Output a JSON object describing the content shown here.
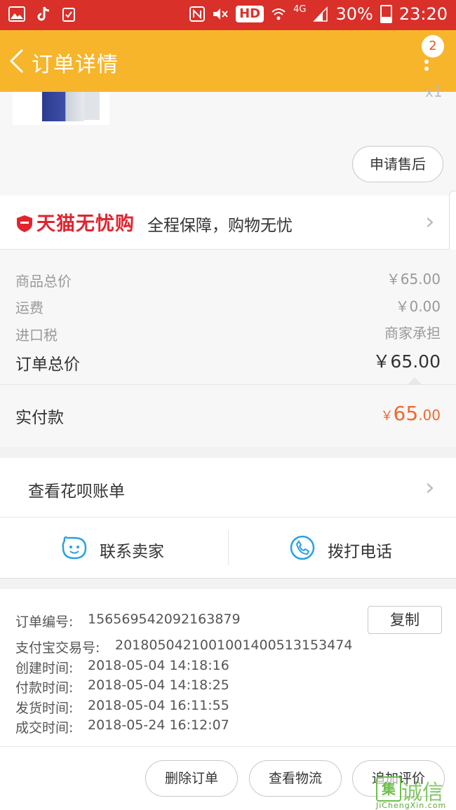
{
  "status_bar": {
    "left_icons": [
      "gallery-icon",
      "tiktok-icon",
      "clipboard-check-icon"
    ],
    "right_icons": [
      "nfc-icon",
      "mute-icon"
    ],
    "hd": "HD",
    "network": "4G",
    "battery": "30%",
    "time": "23:20",
    "bg_color": "#d9302a"
  },
  "nav": {
    "back_glyph": "‹",
    "title": "订单详情",
    "badge": "2",
    "bg_color": "#f7b52c"
  },
  "product": {
    "qty_remnant": "x1",
    "after_sale_button": "申请售后"
  },
  "guarantee": {
    "brand": "天猫无忧购",
    "text": "全程保障，购物无忧",
    "brand_color": "#e1242f"
  },
  "prices": {
    "rows": [
      {
        "label": "商品总价",
        "value": "￥65.00"
      },
      {
        "label": "运费",
        "value": "￥0.00"
      },
      {
        "label": "进口税",
        "value": "商家承担"
      }
    ],
    "total_label": "订单总价",
    "total_value": "￥65.00",
    "paid_label": "实付款",
    "paid_currency": "￥",
    "paid_int": "65",
    "paid_dec": ".00",
    "paid_color": "#f0682a"
  },
  "huabei": {
    "label": "查看花呗账单"
  },
  "contact": {
    "seller_label": "联系卖家",
    "call_label": "拨打电话",
    "icon_color": "#29a1e3"
  },
  "order_info": {
    "order_no_label": "订单编号:",
    "order_no": "156569542092163879",
    "copy_button": "复制",
    "alipay_label": "支付宝交易号:",
    "alipay_no": "2018050421001001400513153474",
    "times": [
      {
        "label": "创建时间:",
        "value": "2018-05-04 14:18:16"
      },
      {
        "label": "付款时间:",
        "value": "2018-05-04 14:18:25"
      },
      {
        "label": "发货时间:",
        "value": "2018-05-04 16:11:55"
      },
      {
        "label": "成交时间:",
        "value": "2018-05-24 16:12:07"
      }
    ]
  },
  "actions": {
    "delete": "删除订单",
    "logistics": "查看物流",
    "review": "追加评价"
  },
  "watermark": {
    "logo_char": "集",
    "cn": "诚信",
    "en": "JiChengXin.com"
  }
}
